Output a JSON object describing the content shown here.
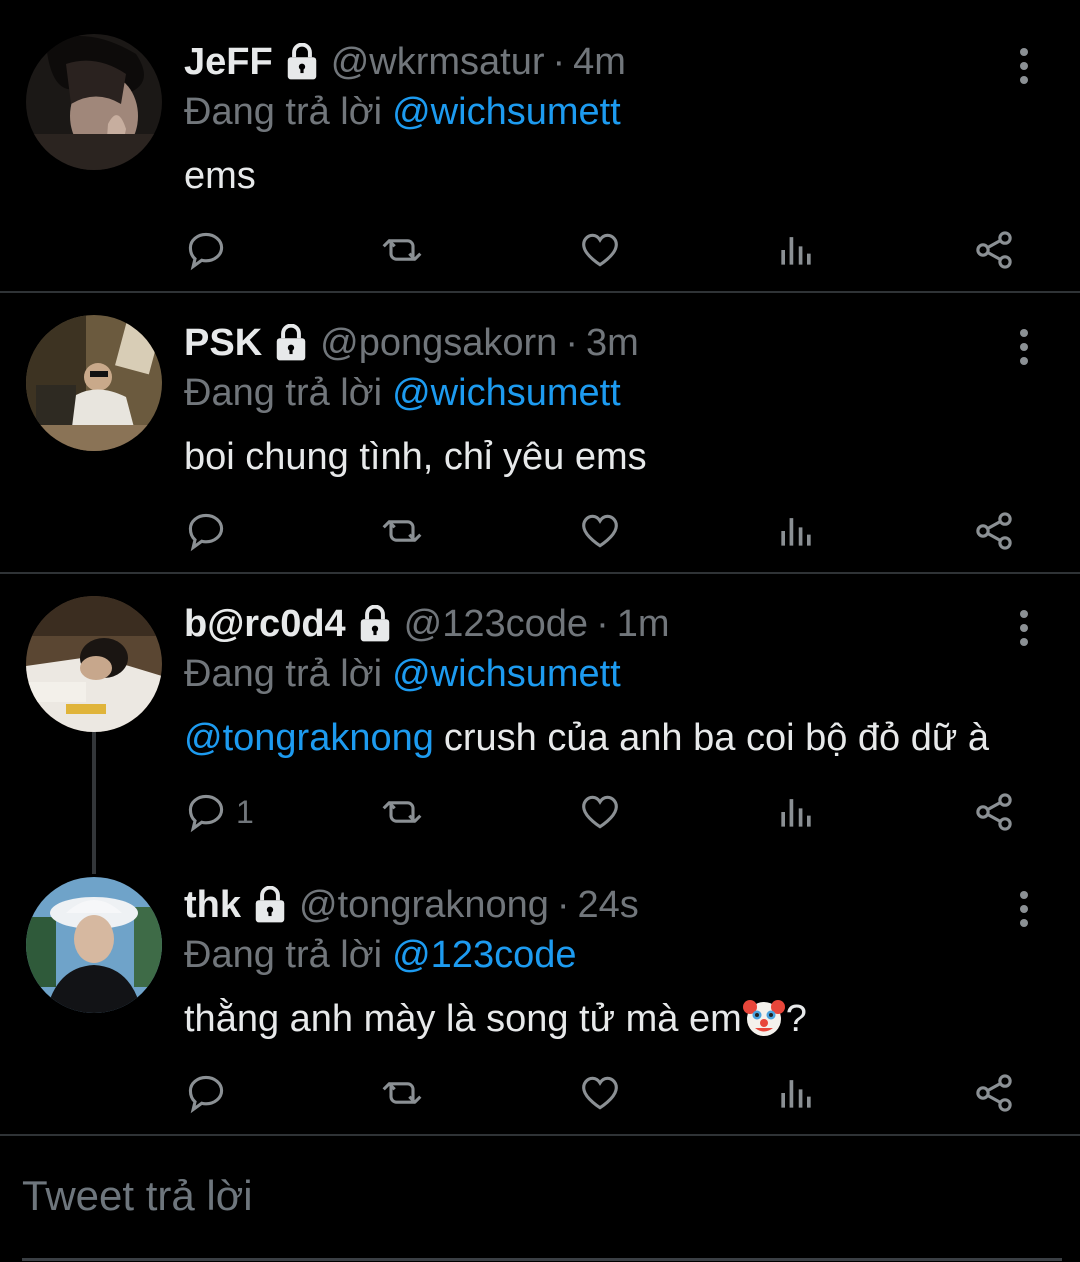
{
  "tweets": [
    {
      "name": "JeFF",
      "handle": "@wkrmsatur",
      "separator": "·",
      "time": "4m",
      "replying_label": "Đang trả lời",
      "replying_to": "@wichsumett",
      "mention": "",
      "text": "ems",
      "reply_count": ""
    },
    {
      "name": "PSK",
      "handle": "@pongsakorn",
      "separator": "·",
      "time": "3m",
      "replying_label": "Đang trả lời",
      "replying_to": "@wichsumett",
      "mention": "",
      "text": "boi chung tình, chỉ yêu ems",
      "reply_count": ""
    },
    {
      "name": "b@rc0d4",
      "handle": "@123code",
      "separator": "·",
      "time": "1m",
      "replying_label": "Đang trả lời",
      "replying_to": "@wichsumett",
      "mention": "@tongraknong",
      "text": "crush của anh ba coi bộ đỏ dữ à",
      "reply_count": "1"
    },
    {
      "name": "thk",
      "handle": "@tongraknong",
      "separator": "·",
      "time": "24s",
      "replying_label": "Đang trả lời",
      "replying_to": "@123code",
      "mention": "",
      "text": "thằng anh mày là song tử mà em",
      "text_suffix": "?",
      "reply_count": ""
    }
  ],
  "icons": {
    "lock": "lock-icon",
    "reply": "reply-icon",
    "retweet": "retweet-icon",
    "like": "heart-icon",
    "analytics": "analytics-icon",
    "share": "share-icon",
    "more": "more-vertical-icon",
    "emoji": "clown-face-emoji"
  },
  "colors": {
    "background": "#000000",
    "text": "#e7e9ea",
    "secondary": "#71767b",
    "link": "#1d9bf0",
    "divider": "#2f3336"
  },
  "composer": {
    "placeholder": "Tweet trả lời"
  }
}
